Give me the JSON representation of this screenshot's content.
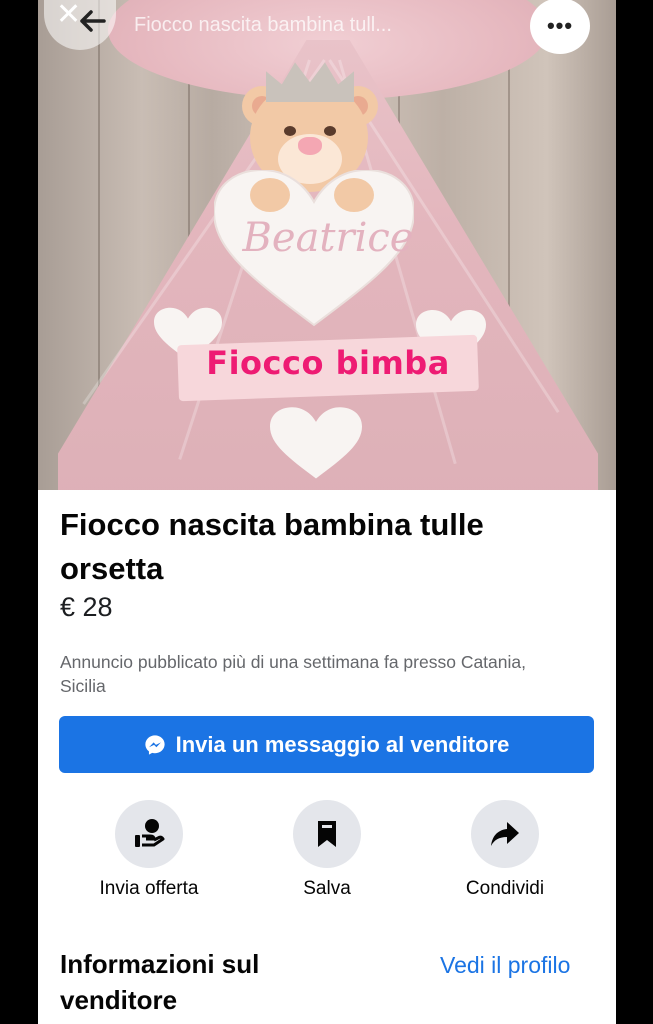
{
  "header": {
    "overlay_title": "Fiocco nascita bambina tull...",
    "close_icon": "close-icon",
    "back_icon": "back-arrow-icon",
    "more_label": "•••"
  },
  "photo": {
    "name_text": "Beatrice",
    "banner_text": "Fiocco bimba"
  },
  "listing": {
    "title": "Fiocco nascita bambina tulle orsetta",
    "price": "€ 28",
    "meta": "Annuncio pubblicato più di una settimana fa presso Catania, Sicilia"
  },
  "message_button": {
    "label": "Invia un messaggio al venditore",
    "icon": "messenger-icon"
  },
  "actions": [
    {
      "label": "Invia offerta",
      "icon": "offer-hand-icon"
    },
    {
      "label": "Salva",
      "icon": "bookmark-icon"
    },
    {
      "label": "Condividi",
      "icon": "share-arrow-icon"
    }
  ],
  "seller": {
    "section_title": "Informazioni sul venditore",
    "profile_link": "Vedi il profilo"
  },
  "colors": {
    "accent": "#1b74e4",
    "banner_text": "#ee1b73",
    "background": "#ffffff"
  }
}
